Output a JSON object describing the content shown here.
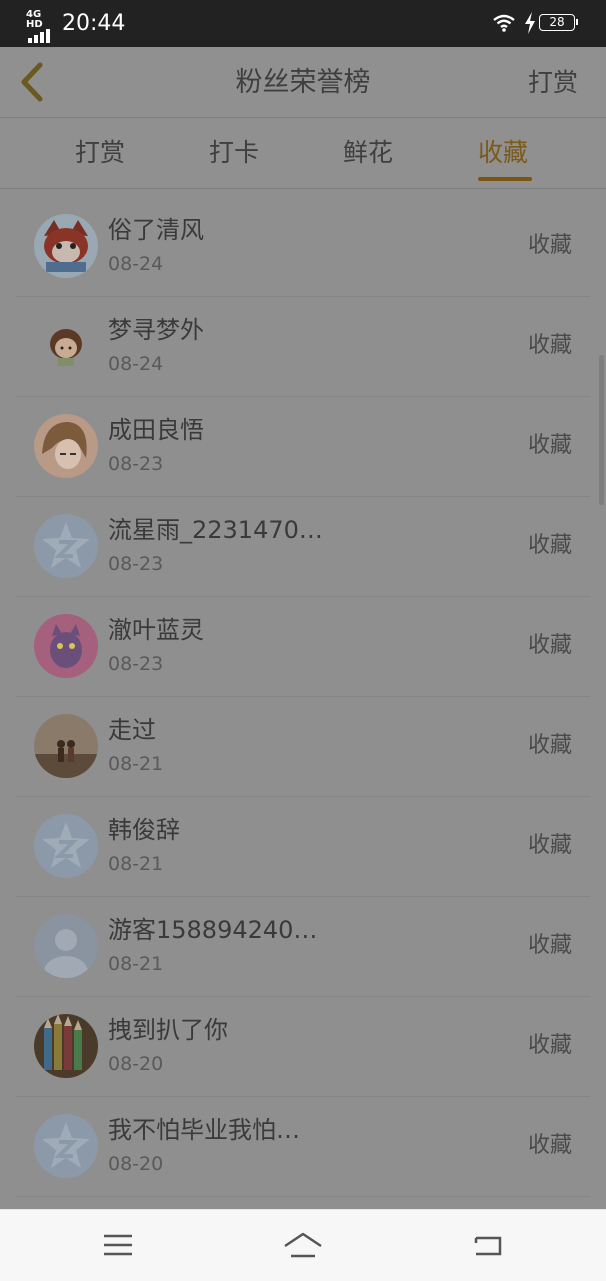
{
  "status_bar": {
    "network_label": "4G HD",
    "time": "20:44",
    "battery": "28",
    "icons": [
      "signal-icon",
      "wifi-icon",
      "charging-icon",
      "battery-icon"
    ]
  },
  "header": {
    "back_icon": "chevron-left-icon",
    "title": "粉丝荣誉榜",
    "action": "打赏"
  },
  "tabs": [
    {
      "label": "打赏"
    },
    {
      "label": "打卡"
    },
    {
      "label": "鲜花"
    },
    {
      "label": "收藏",
      "active": true
    }
  ],
  "list": {
    "items": [
      {
        "name": "俗了清风",
        "date": "08-24",
        "type": "收藏",
        "avatar": "cartoon-fox-avatar"
      },
      {
        "name": "梦寻梦外",
        "date": "08-24",
        "type": "收藏",
        "avatar": "cartoon-girl-avatar"
      },
      {
        "name": "成田良悟",
        "date": "08-23",
        "type": "收藏",
        "avatar": "anime-girl-avatar"
      },
      {
        "name": "流星雨_2231470…",
        "date": "08-23",
        "type": "收藏",
        "avatar": "default-star-avatar"
      },
      {
        "name": "澈叶蓝灵",
        "date": "08-23",
        "type": "收藏",
        "avatar": "pink-cat-avatar"
      },
      {
        "name": "走过",
        "date": "08-21",
        "type": "收藏",
        "avatar": "couple-photo-avatar"
      },
      {
        "name": "韩俊辞",
        "date": "08-21",
        "type": "收藏",
        "avatar": "default-star-avatar"
      },
      {
        "name": "游客158894240…",
        "date": "08-21",
        "type": "收藏",
        "avatar": "default-person-avatar"
      },
      {
        "name": "拽到扒了你",
        "date": "08-20",
        "type": "收藏",
        "avatar": "pencils-avatar"
      },
      {
        "name": "我不怕毕业我怕…",
        "date": "08-20",
        "type": "收藏",
        "avatar": "default-star-avatar"
      }
    ]
  },
  "system_nav": [
    "menu-icon",
    "home-icon",
    "back-icon"
  ],
  "colors": {
    "accent": "#7a5a1c",
    "overlay_bg": "#8f8f8f",
    "status_bar": "#222222",
    "nav_bar": "#f7f7f7"
  }
}
